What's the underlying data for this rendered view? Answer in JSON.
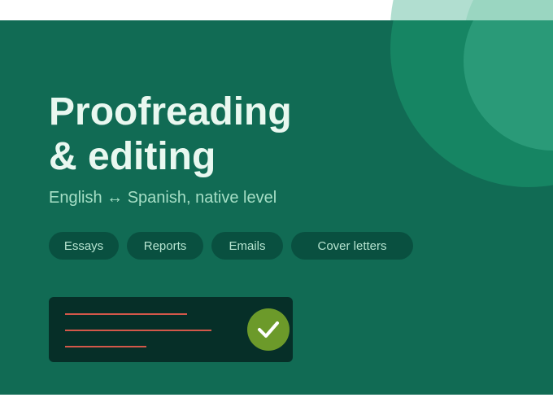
{
  "hero": {
    "title_line1": "Proofreading",
    "title_line2": "& editing",
    "subtitle": "English ↔ Spanish, native level"
  },
  "tags": [
    {
      "label": "Essays"
    },
    {
      "label": "Reports"
    },
    {
      "label": "Emails"
    },
    {
      "label": "Cover letters"
    }
  ],
  "illustration": {
    "check_icon": "check-icon",
    "lines_icon": "text-lines"
  },
  "colors": {
    "banner_bg": "#116b54",
    "title": "#e9f8f0",
    "subtitle": "#a6dfc6",
    "chip_bg": "#095040",
    "chip_text": "#b6e4d0",
    "card_bg": "#062f28",
    "error_line": "#d2584a",
    "check_bg": "#6c9a2a"
  }
}
